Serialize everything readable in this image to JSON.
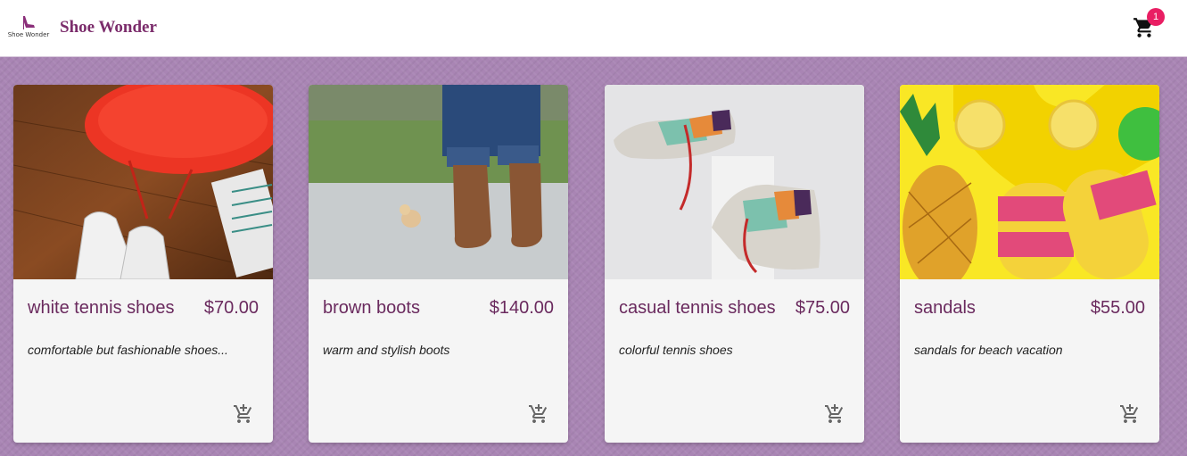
{
  "header": {
    "logo_text": "Shoe Wonder",
    "brand": "Shoe Wonder",
    "cart_count": "1"
  },
  "products": [
    {
      "name": "white tennis shoes",
      "price": "$70.00",
      "description": "comfortable but fashionable shoes..."
    },
    {
      "name": "brown boots",
      "price": "$140.00",
      "description": "warm and stylish boots"
    },
    {
      "name": "casual tennis shoes",
      "price": "$75.00",
      "description": "colorful tennis shoes"
    },
    {
      "name": "sandals",
      "price": "$55.00",
      "description": "sandals for beach vacation"
    }
  ],
  "colors": {
    "background": "#a985b4",
    "brand": "#7b2c6b",
    "badge": "#e91e63"
  },
  "icons": {
    "cart": "shopping-cart-icon",
    "add_to_cart": "add-shopping-cart-icon",
    "logo": "high-heel-icon"
  }
}
